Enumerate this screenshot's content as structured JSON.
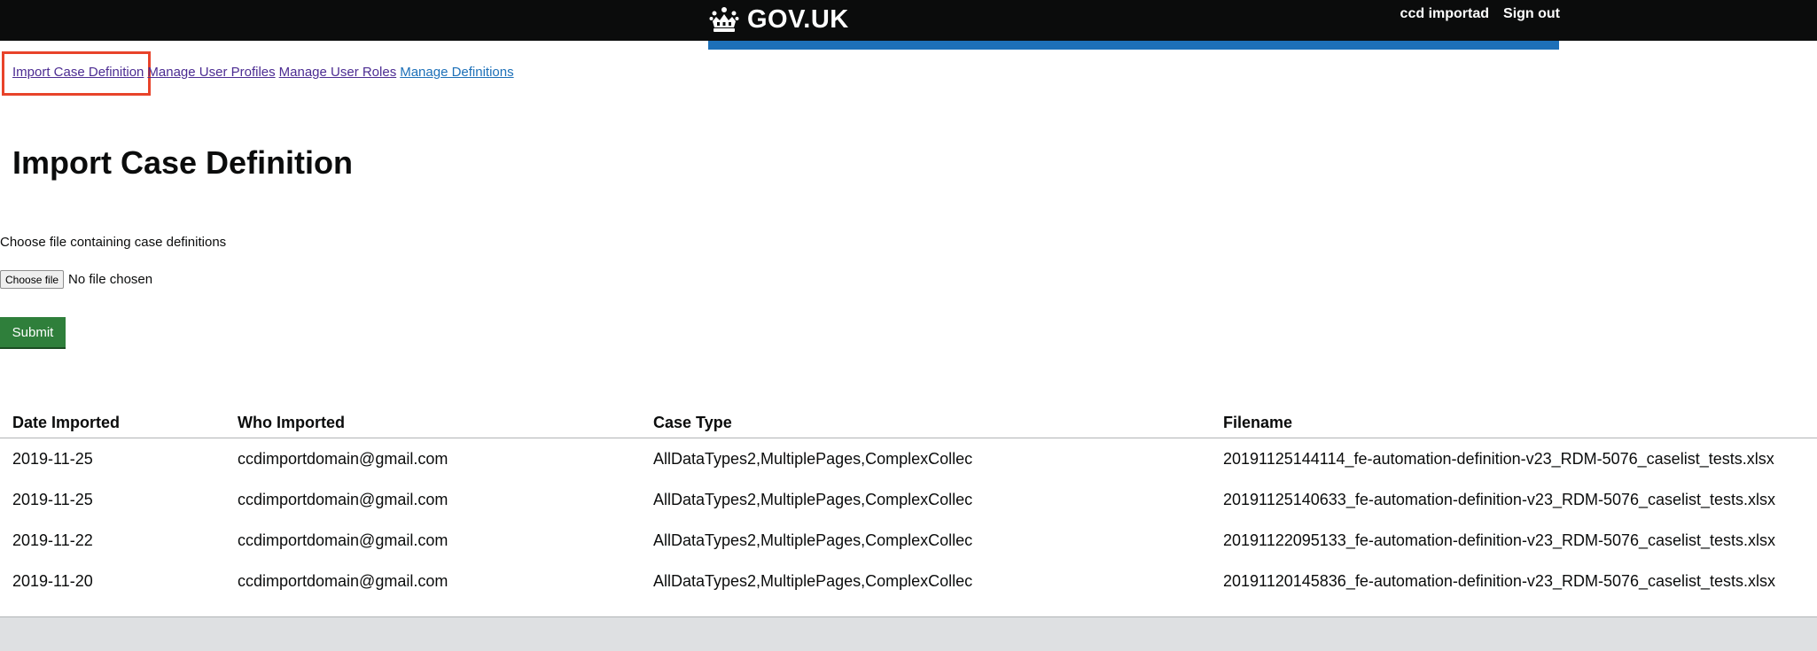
{
  "header": {
    "logo_text": "GOV.UK",
    "logo_icon": "crown-icon",
    "user_name": "ccd importad",
    "sign_out_label": "Sign out"
  },
  "nav": {
    "items": [
      {
        "label": "Import Case Definition"
      },
      {
        "label": "Manage User Profiles"
      },
      {
        "label": "Manage User Roles"
      },
      {
        "label": "Manage Definitions"
      }
    ]
  },
  "page": {
    "title": "Import Case Definition",
    "file_label": "Choose file containing case definitions",
    "choose_file_label": "Choose file",
    "no_file_text": "No file chosen",
    "submit_label": "Submit"
  },
  "table": {
    "headers": [
      "Date Imported",
      "Who Imported",
      "Case Type",
      "Filename"
    ],
    "rows": [
      [
        "2019-11-25",
        "ccdimportdomain@gmail.com",
        "AllDataTypes2,MultiplePages,ComplexCollec",
        "20191125144114_fe-automation-definition-v23_RDM-5076_caselist_tests.xlsx"
      ],
      [
        "2019-11-25",
        "ccdimportdomain@gmail.com",
        "AllDataTypes2,MultiplePages,ComplexCollec",
        "20191125140633_fe-automation-definition-v23_RDM-5076_caselist_tests.xlsx"
      ],
      [
        "2019-11-22",
        "ccdimportdomain@gmail.com",
        "AllDataTypes2,MultiplePages,ComplexCollec",
        "20191122095133_fe-automation-definition-v23_RDM-5076_caselist_tests.xlsx"
      ],
      [
        "2019-11-20",
        "ccdimportdomain@gmail.com",
        "AllDataTypes2,MultiplePages,ComplexCollec",
        "20191120145836_fe-automation-definition-v23_RDM-5076_caselist_tests.xlsx"
      ]
    ]
  },
  "colors": {
    "header_bg": "#0b0c0c",
    "accent_blue": "#1d70b8",
    "link_visited": "#4c2c92",
    "submit_green": "#2f7f3b",
    "highlight_red": "#e8432a",
    "footer_bg": "#dee0e2"
  }
}
